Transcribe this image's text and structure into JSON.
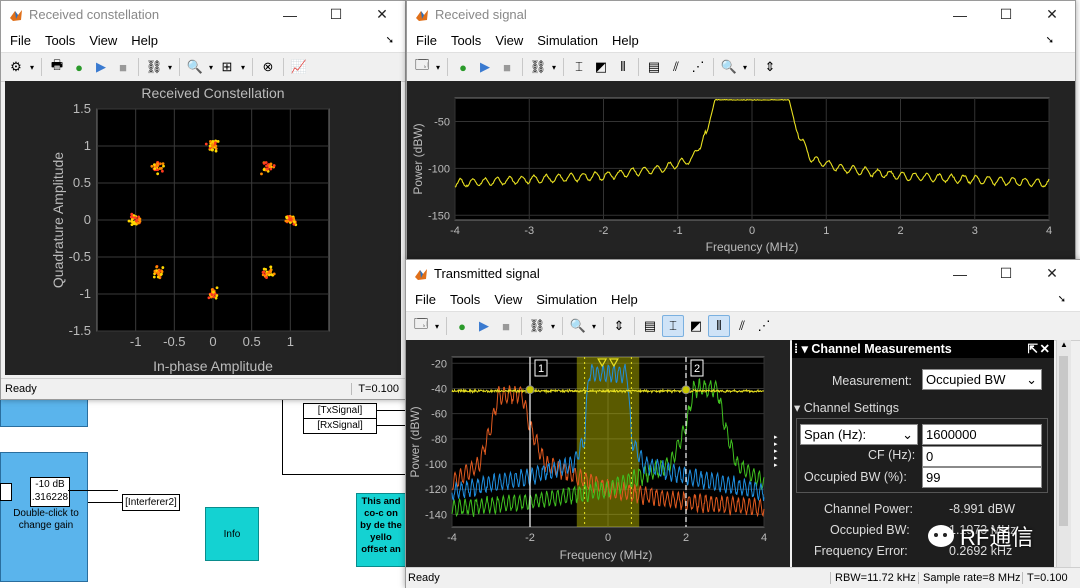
{
  "constellation_window": {
    "title": "Received constellation",
    "menu": [
      "File",
      "Tools",
      "View",
      "Help"
    ],
    "plot_title": "Received Constellation",
    "status_left": "Ready",
    "status_right": "T=0.100",
    "chart_data": {
      "type": "scatter",
      "title": "Received Constellation",
      "xlabel": "In-phase Amplitude",
      "ylabel": "Quadrature Amplitude",
      "xlim": [
        -1.5,
        1.5
      ],
      "ylim": [
        -1.5,
        1.5
      ],
      "xticks": [
        "-1",
        "-0.5",
        "0",
        "0.5",
        "1"
      ],
      "yticks": [
        "1.5",
        "1",
        "0.5",
        "0",
        "-0.5",
        "-1",
        "-1.5"
      ],
      "clusters": [
        {
          "x": 1.0,
          "y": 0.0
        },
        {
          "x": 0.71,
          "y": 0.71
        },
        {
          "x": 0.0,
          "y": 1.0
        },
        {
          "x": -0.71,
          "y": 0.71
        },
        {
          "x": -1.0,
          "y": 0.0
        },
        {
          "x": -0.71,
          "y": -0.71
        },
        {
          "x": 0.0,
          "y": -1.0
        },
        {
          "x": 0.71,
          "y": -0.71
        }
      ],
      "colors": [
        "#ffd700",
        "#ff8c00",
        "#ff3b1f"
      ]
    }
  },
  "received_window": {
    "title": "Received signal",
    "menu": [
      "File",
      "Tools",
      "View",
      "Simulation",
      "Help"
    ],
    "chart_data": {
      "type": "line",
      "xlabel": "Frequency (MHz)",
      "ylabel": "Power (dBW)",
      "xlim": [
        -4,
        4
      ],
      "ylim": [
        -155,
        -25
      ],
      "xticks": [
        "-4",
        "-3",
        "-2",
        "-1",
        "0",
        "1",
        "2",
        "3",
        "4"
      ],
      "yticks": [
        "-50",
        "-100",
        "-150"
      ],
      "series": [
        {
          "color": "#e8e020",
          "x": [
            -4,
            -3,
            -2,
            -1.2,
            -0.8,
            -0.6,
            -0.5,
            0,
            0.5,
            0.6,
            0.8,
            1.2,
            2,
            3,
            4
          ],
          "values": [
            -116,
            -112,
            -108,
            -100,
            -90,
            -60,
            -27,
            -27,
            -27,
            -60,
            -90,
            -100,
            -108,
            -112,
            -116
          ]
        }
      ]
    }
  },
  "transmitted_window": {
    "title": "Transmitted signal",
    "menu": [
      "File",
      "Tools",
      "View",
      "Simulation",
      "Help"
    ],
    "status_left": "Ready",
    "status_rbw": "RBW=11.72 kHz",
    "status_rate": "Sample rate=8 MHz",
    "status_time": "T=0.100",
    "marker1": "1",
    "marker2": "2",
    "chart_data": {
      "type": "line",
      "xlabel": "Frequency (MHz)",
      "ylabel": "Power (dBW)",
      "xlim": [
        -4,
        4
      ],
      "ylim": [
        -150,
        -15
      ],
      "xticks": [
        "-4",
        "-2",
        "0",
        "2",
        "4"
      ],
      "yticks": [
        "-20",
        "-40",
        "-60",
        "-80",
        "-100",
        "-120",
        "-140"
      ],
      "series": [
        {
          "color": "#e8e020",
          "x": [
            -4,
            4
          ],
          "values": [
            -42,
            -42
          ]
        },
        {
          "color": "#1f8fe0",
          "x": [
            -4,
            -2,
            -0.9,
            -0.6,
            -0.5,
            0.5,
            0.6,
            0.9,
            2,
            4
          ],
          "values": [
            -122,
            -110,
            -100,
            -80,
            -28,
            -28,
            -80,
            -100,
            -110,
            -122
          ]
        },
        {
          "color": "#e05a20",
          "x": [
            -4,
            -3.3,
            -3,
            -2.8,
            -2.2,
            -2,
            -1.6,
            0,
            2,
            4
          ],
          "values": [
            -115,
            -100,
            -70,
            -45,
            -45,
            -70,
            -100,
            -120,
            -130,
            -135
          ]
        },
        {
          "color": "#40c020",
          "x": [
            -4,
            -2,
            0,
            1.6,
            2,
            2.2,
            2.8,
            3,
            3.3,
            4
          ],
          "values": [
            -135,
            -130,
            -120,
            -100,
            -70,
            -40,
            -40,
            -70,
            -100,
            -115
          ]
        }
      ],
      "marker_x": [
        -2,
        2
      ],
      "occupied_band": [
        -0.8,
        0.8
      ]
    },
    "measurements": {
      "header": "Channel Measurements",
      "measurement_label": "Measurement:",
      "measurement_value": "Occupied BW",
      "settings_header": "Channel Settings",
      "span_label": "Span (Hz):",
      "span_value": "1600000",
      "cf_label": "CF (Hz):",
      "cf_value": "0",
      "obw_label": "Occupied BW (%):",
      "obw_value": "99",
      "channel_power_label": "Channel Power:",
      "channel_power_value": "-8.991  dBW",
      "occupied_bw_label": "Occupied BW:",
      "occupied_bw_value": "1.1973 MHz",
      "freq_error_label": "Frequency Error:",
      "freq_error_value": "0.2692 kHz"
    }
  },
  "simulink": {
    "txsignal": "[TxSignal]",
    "rxsignal": "[RxSignal]",
    "interferer2": "[Interferer2]",
    "gain_value": "-10 dB",
    "gain_sub": ".316228",
    "gain_caption": "Double-click to change gain",
    "info_label": "Info",
    "note_text": "This and co-c on by de the yello offset an"
  },
  "watermark": "RF通信"
}
